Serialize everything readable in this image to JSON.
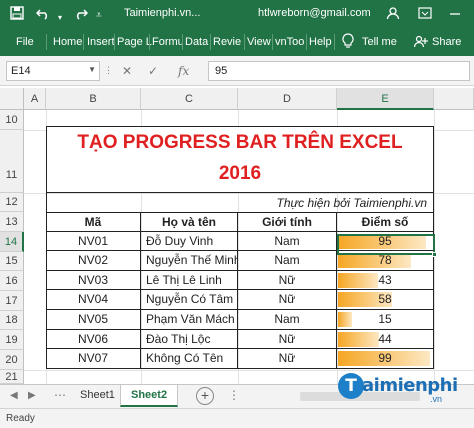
{
  "titlebar": {
    "save_icon": "save-icon",
    "undo_icon": "undo-icon",
    "redo_icon": "redo-icon",
    "title": "Taimienphi.vn...",
    "user": "htlwreborn@gmail.com",
    "user_icon": "user-icon",
    "restore_icon": "ribbon-display-icon",
    "min_icon": "minimize-icon"
  },
  "ribbon": {
    "tabs": [
      "File",
      "Home",
      "Insert",
      "Page L",
      "Formu",
      "Data",
      "Revie",
      "View",
      "vnToo",
      "Help"
    ],
    "tell_me": "Tell me",
    "share": "Share"
  },
  "formula": {
    "name_box": "E14",
    "cancel_glyph": "✕",
    "enter_glyph": "✓",
    "fx_glyph": "fx",
    "value": "95"
  },
  "columns": [
    "A",
    "B",
    "C",
    "D",
    "E"
  ],
  "rows": [
    "10",
    "11",
    "12",
    "13",
    "14",
    "15",
    "16",
    "17",
    "18",
    "19",
    "20",
    "21"
  ],
  "sheet": {
    "title_line1": "TẠO PROGRESS BAR TRÊN EXCEL",
    "title_line2": "2016",
    "subtitle": "Thực hiện bởi Taimienphi.vn",
    "headers": [
      "Mã",
      "Họ và tên",
      "Giới tính",
      "Điểm số"
    ],
    "records": [
      {
        "id": "NV01",
        "name": "Đỗ Duy Vinh",
        "gender": "Nam",
        "score": "95"
      },
      {
        "id": "NV02",
        "name": "Nguyễn Thế Minh",
        "gender": "Nam",
        "score": "78"
      },
      {
        "id": "NV03",
        "name": "Lê Thị Lê Linh",
        "gender": "Nữ",
        "score": "43"
      },
      {
        "id": "NV04",
        "name": "Nguyễn Có  Tâm",
        "gender": "Nữ",
        "score": "58"
      },
      {
        "id": "NV05",
        "name": "Phạm Văn Mách",
        "gender": "Nam",
        "score": "15"
      },
      {
        "id": "NV06",
        "name": "Đào Thị Lộc",
        "gender": "Nữ",
        "score": "44"
      },
      {
        "id": "NV07",
        "name": "Không Có Tên",
        "gender": "Nữ",
        "score": "99"
      }
    ],
    "bar_color": "#f5a623"
  },
  "sheet_tabs": {
    "tabs": [
      "Sheet1",
      "Sheet2"
    ],
    "active": "Sheet2",
    "add_glyph": "+"
  },
  "status": {
    "ready": "Ready"
  },
  "logo": {
    "initial": "T",
    "text": "aimienphi",
    "suffix": ".vn"
  }
}
